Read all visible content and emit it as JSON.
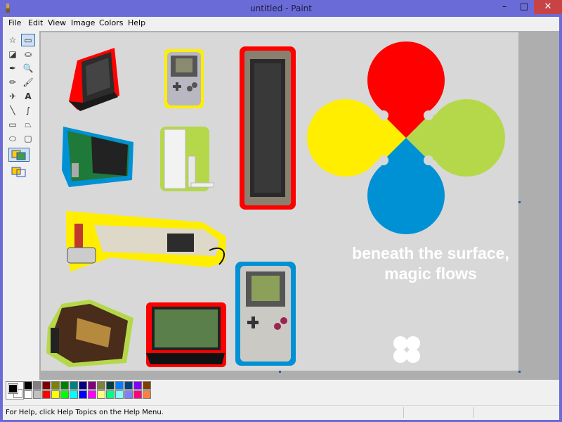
{
  "window": {
    "title": "untitled - Paint",
    "minimize_glyph": "–",
    "maximize_glyph": "□",
    "close_glyph": "✕"
  },
  "menu": {
    "items": [
      "File",
      "Edit",
      "View",
      "Image",
      "Colors",
      "Help"
    ]
  },
  "tools": [
    {
      "name": "free-form-select-icon",
      "glyph": "☆"
    },
    {
      "name": "select-icon",
      "glyph": "▭"
    },
    {
      "name": "eraser-icon",
      "glyph": "◪"
    },
    {
      "name": "fill-icon",
      "glyph": "⛀"
    },
    {
      "name": "pick-color-icon",
      "glyph": "✒"
    },
    {
      "name": "magnifier-icon",
      "glyph": "🔍"
    },
    {
      "name": "pencil-icon",
      "glyph": "✏"
    },
    {
      "name": "brush-icon",
      "glyph": "🖌"
    },
    {
      "name": "airbrush-icon",
      "glyph": "✈"
    },
    {
      "name": "text-icon",
      "glyph": "A"
    },
    {
      "name": "line-icon",
      "glyph": "╲"
    },
    {
      "name": "curve-icon",
      "glyph": "∫"
    },
    {
      "name": "rectangle-icon",
      "glyph": "▭"
    },
    {
      "name": "polygon-icon",
      "glyph": "⏢"
    },
    {
      "name": "ellipse-icon",
      "glyph": "⬭"
    },
    {
      "name": "rounded-rectangle-icon",
      "glyph": "▢"
    }
  ],
  "canvas": {
    "slogan_line1": "beneath the surface,",
    "slogan_line2": "magic flows",
    "logo_colors": {
      "red": "#ff0000",
      "yellow": "#ffee00",
      "green": "#b5d84a",
      "blue": "#0091d5"
    }
  },
  "palette": {
    "row1": [
      "#000000",
      "#808080",
      "#800000",
      "#808000",
      "#008000",
      "#008080",
      "#000080",
      "#800080",
      "#808040",
      "#004040",
      "#0080ff",
      "#004080",
      "#8000ff",
      "#804000"
    ],
    "row2": [
      "#ffffff",
      "#c0c0c0",
      "#ff0000",
      "#ffff00",
      "#00ff00",
      "#00ffff",
      "#0000ff",
      "#ff00ff",
      "#ffff80",
      "#00ff80",
      "#80ffff",
      "#8080ff",
      "#ff0080",
      "#ff8040"
    ]
  },
  "status": {
    "help_text": "For Help, click Help Topics on the Help Menu."
  }
}
